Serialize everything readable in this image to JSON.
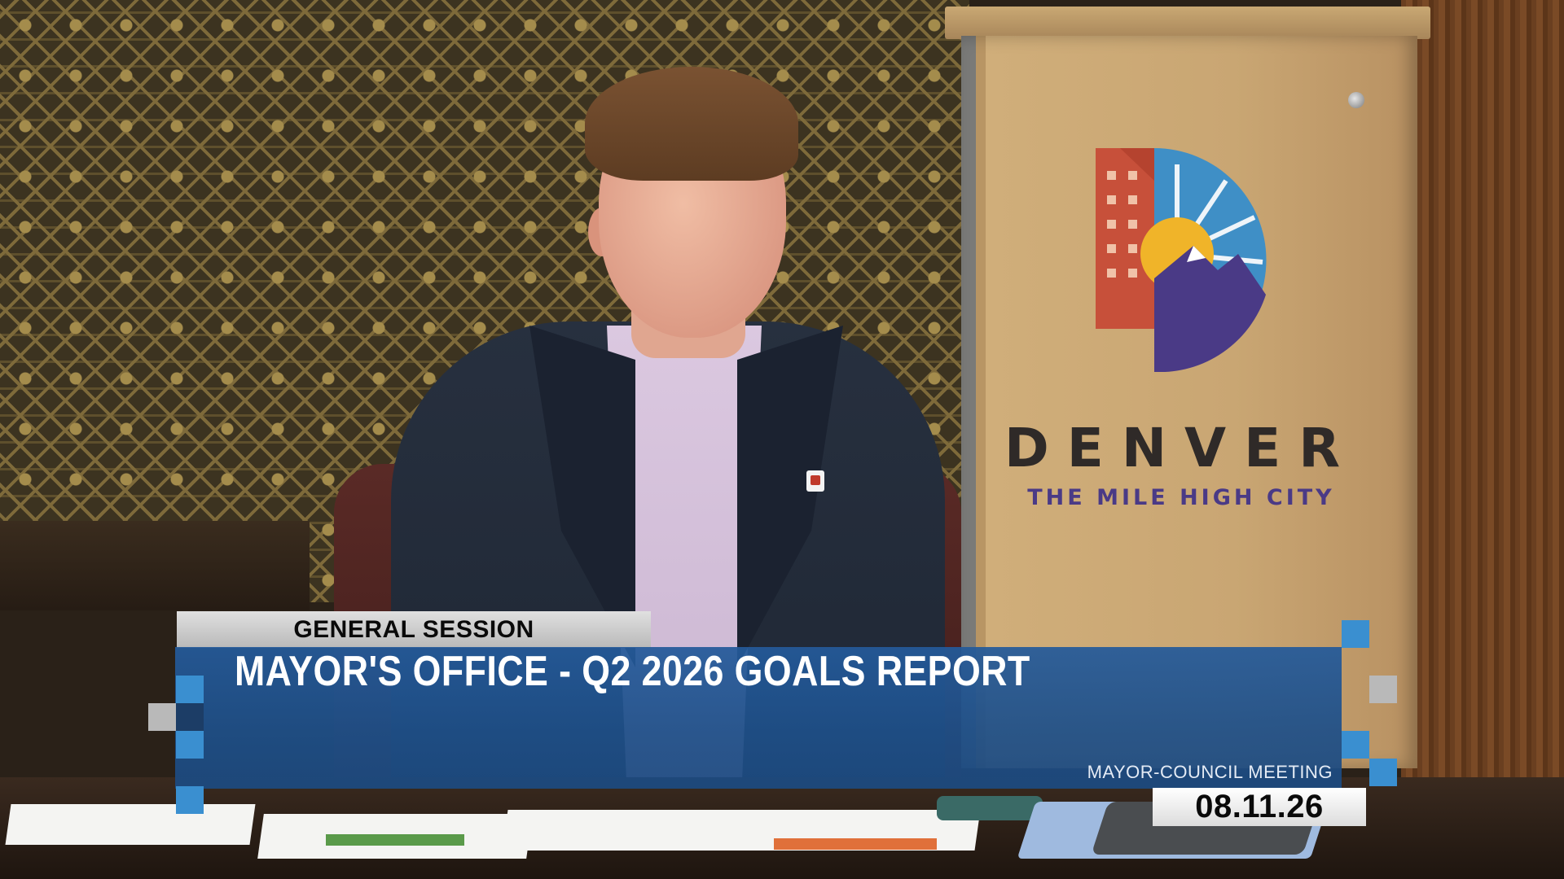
{
  "background": {
    "podium_logo": {
      "wordmark": "DENVER",
      "tagline": "THE MILE HIGH CITY"
    }
  },
  "lower_third": {
    "section": "GENERAL SESSION",
    "title": "MAYOR'S OFFICE - Q2 2026 GOALS REPORT",
    "meeting": "MAYOR-COUNCIL MEETING",
    "date": "08.11.26"
  },
  "colors": {
    "banner_blue": "#1e4f88",
    "accent_blue": "#3a8fd0",
    "tab_grey": "#c8c8c8",
    "logo_red": "#c7503a",
    "logo_purple": "#4a3a86",
    "logo_sun": "#f0b429",
    "logo_sky": "#3f8fc6"
  }
}
